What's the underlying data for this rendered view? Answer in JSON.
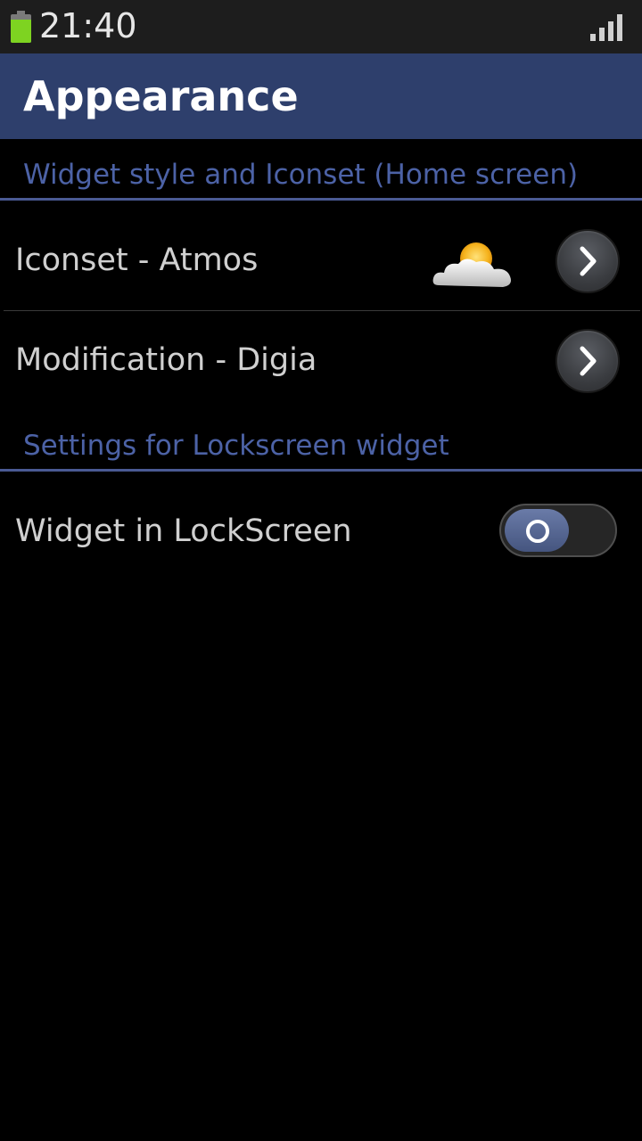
{
  "status_bar": {
    "time": "21:40",
    "battery_level": 0.8,
    "signal_level": 4,
    "battery_color": "#7ed321"
  },
  "header": {
    "title": "Appearance",
    "color": "#2e3f6c"
  },
  "sections": [
    {
      "label": "Widget style and Iconset (Home screen)",
      "items": [
        {
          "label": "Iconset - Atmos",
          "icon": "partly-cloudy-icon",
          "action_icon": "chevron-right-icon"
        },
        {
          "label": "Modification - Digia",
          "action_icon": "chevron-right-icon"
        }
      ]
    },
    {
      "label": "Settings for Lockscreen widget",
      "items": [
        {
          "label": "Widget in LockScreen",
          "control": "toggle",
          "value": false
        }
      ]
    }
  ],
  "accent_color": "#4c62a6"
}
